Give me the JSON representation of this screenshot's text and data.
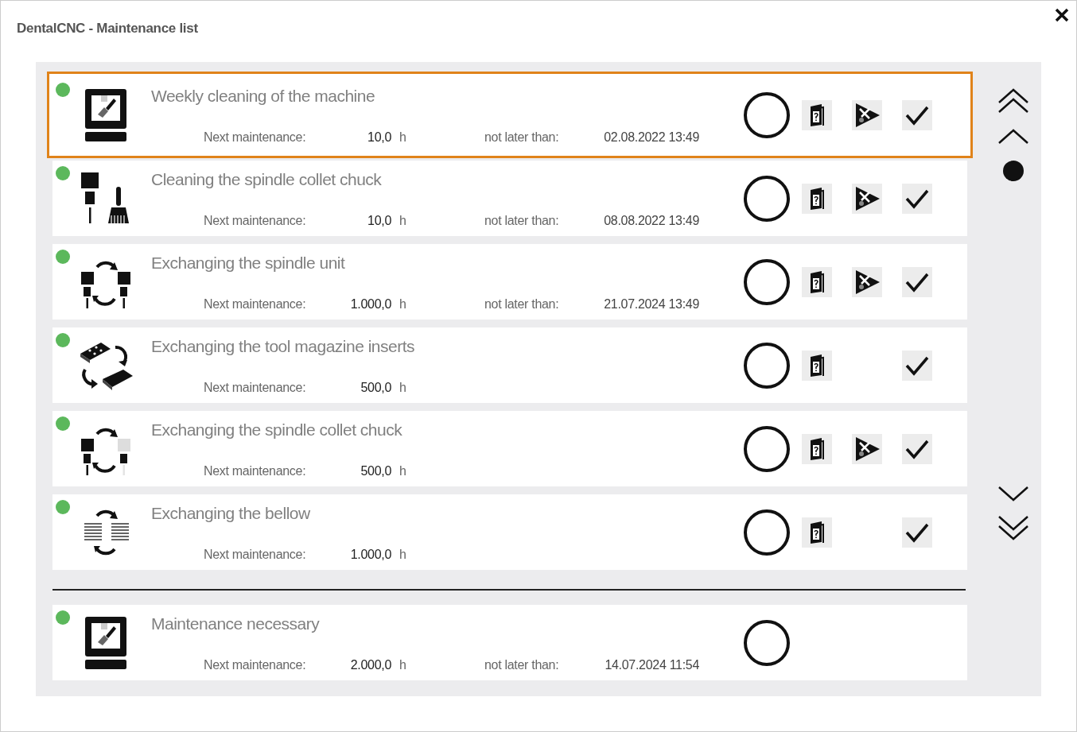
{
  "window": {
    "title": "DentalCNC - Maintenance list"
  },
  "tasks": [
    {
      "kind": "machine-brush",
      "color": "#5cb85c",
      "selected": true,
      "title": "Weekly cleaning of the machine",
      "next_label": "Next maintenance:",
      "hours": "10,0",
      "unit": "h",
      "deadline_label": "not later than:",
      "deadline": "02.08.2022 13:49",
      "done": false,
      "actions": [
        {
          "kind": "manual"
        },
        {
          "kind": "start"
        },
        {
          "kind": "confirm"
        }
      ]
    },
    {
      "kind": "spindle-brush",
      "color": "#5cb85c",
      "selected": false,
      "title": "Cleaning the spindle collet chuck",
      "next_label": "Next maintenance:",
      "hours": "10,0",
      "unit": "h",
      "deadline_label": "not later than:",
      "deadline": "08.08.2022 13:49",
      "done": false,
      "actions": [
        {
          "kind": "manual"
        },
        {
          "kind": "start"
        },
        {
          "kind": "confirm"
        }
      ]
    },
    {
      "kind": "spindle-exchange",
      "color": "#5cb85c",
      "selected": false,
      "title": "Exchanging the spindle unit",
      "next_label": "Next maintenance:",
      "hours": "1.000,0",
      "unit": "h",
      "deadline_label": "not later than:",
      "deadline": "21.07.2024 13:49",
      "done": false,
      "actions": [
        {
          "kind": "manual"
        },
        {
          "kind": "start"
        },
        {
          "kind": "confirm"
        }
      ]
    },
    {
      "kind": "magazine-exchange",
      "color": "#5cb85c",
      "selected": false,
      "title": "Exchanging the tool magazine inserts",
      "next_label": "Next maintenance:",
      "hours": "500,0",
      "unit": "h",
      "done": false,
      "actions": [
        {
          "kind": "manual"
        },
        {
          "kind": "none"
        },
        {
          "kind": "confirm"
        }
      ]
    },
    {
      "kind": "collet-exchange",
      "color": "#5cb85c",
      "selected": false,
      "title": "Exchanging the spindle collet chuck",
      "next_label": "Next maintenance:",
      "hours": "500,0",
      "unit": "h",
      "done": false,
      "actions": [
        {
          "kind": "manual"
        },
        {
          "kind": "start"
        },
        {
          "kind": "confirm"
        }
      ]
    },
    {
      "kind": "bellow-exchange",
      "color": "#5cb85c",
      "selected": false,
      "title": "Exchanging the bellow",
      "next_label": "Next maintenance:",
      "hours": "1.000,0",
      "unit": "h",
      "done": false,
      "actions": [
        {
          "kind": "manual"
        },
        {
          "kind": "none"
        },
        {
          "kind": "confirm"
        }
      ]
    }
  ],
  "summary": [
    {
      "kind": "machine-brush",
      "color": "#5cb85c",
      "selected": false,
      "title": "Maintenance necessary",
      "next_label": "Next maintenance:",
      "hours": "2.000,0",
      "unit": "h",
      "deadline_label": "not later than:",
      "deadline": "14.07.2024 11:54",
      "done": false
    }
  ]
}
